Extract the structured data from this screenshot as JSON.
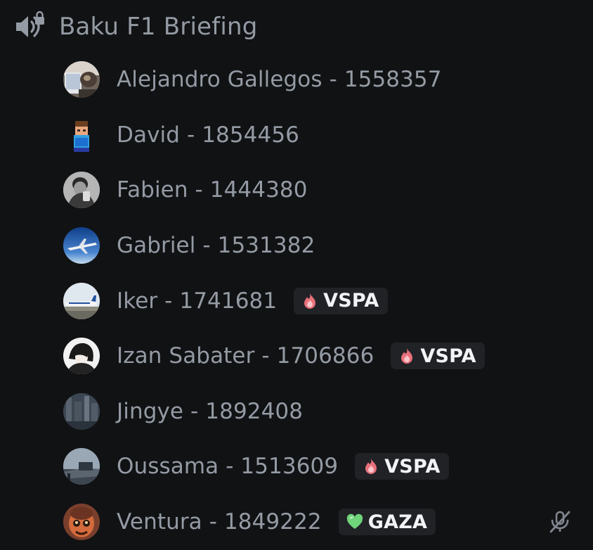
{
  "channel": {
    "name": "Baku F1 Briefing",
    "icon": "speaker-lock-icon"
  },
  "members": [
    {
      "name": "Alejandro Gallegos - 1558357",
      "avatar": "laptop-cat-avatar"
    },
    {
      "name": "David - 1854456",
      "avatar": "pixel-character-avatar"
    },
    {
      "name": "Fabien - 1444380",
      "avatar": "grayscale-selfie-avatar"
    },
    {
      "name": "Gabriel - 1531382",
      "avatar": "airplane-sky-avatar"
    },
    {
      "name": "Iker - 1741681",
      "avatar": "airliner-runway-avatar",
      "tag": {
        "label": "VSPA",
        "icon": "flame-icon"
      }
    },
    {
      "name": "Izan Sabater - 1706866",
      "avatar": "anime-character-avatar",
      "tag": {
        "label": "VSPA",
        "icon": "flame-icon"
      }
    },
    {
      "name": "Jingye - 1892408",
      "avatar": "city-aerial-avatar"
    },
    {
      "name": "Oussama - 1513609",
      "avatar": "aircraft-jetbridge-avatar",
      "tag": {
        "label": "VSPA",
        "icon": "flame-icon"
      }
    },
    {
      "name": "Ventura - 1849222",
      "avatar": "cartoon-character-avatar",
      "tag": {
        "label": "GAZA",
        "icon": "green-heart-icon"
      },
      "muted": true
    }
  ],
  "colors": {
    "background": "#111214",
    "text_muted": "#949ba4",
    "tag_bg": "#202226",
    "tag_text": "#f2f3f5",
    "vspa_flame": "#e8707a",
    "gaza_heart": "#6fd47a"
  }
}
